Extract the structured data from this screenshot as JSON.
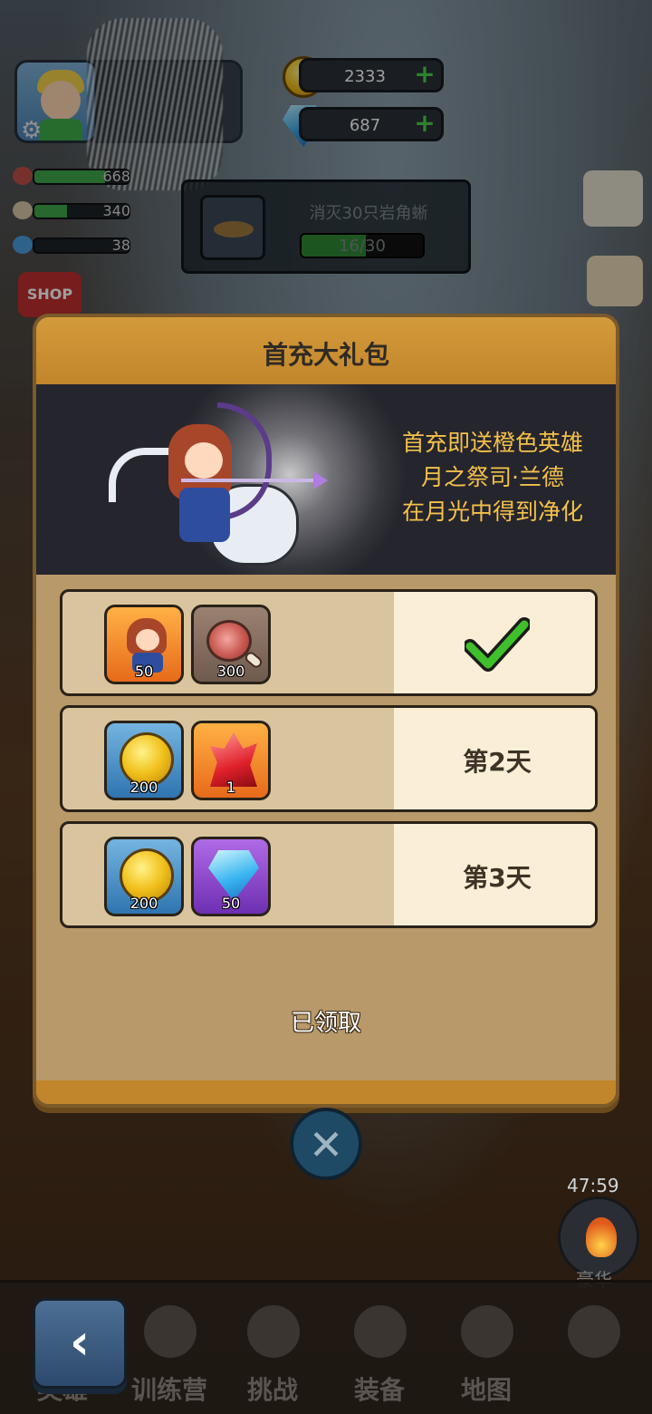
{
  "hud": {
    "coins": "2333",
    "gems": "687",
    "plus": "+",
    "stats": [
      {
        "value": "668",
        "level": 0.75
      },
      {
        "value": "340",
        "level": 0.35
      },
      {
        "value": "38",
        "level": 0.0
      }
    ],
    "quest": {
      "title": "消灭30只岩角蜥",
      "progress": "16/30",
      "level": 0.53
    },
    "shop_label": "SHOP"
  },
  "modal": {
    "title": "首充大礼包",
    "promo": [
      "首充即送橙色英雄",
      "月之祭司·兰德",
      "在月光中得到净化"
    ],
    "rows": [
      {
        "items": [
          {
            "icon": "hero-icon",
            "count": "50"
          },
          {
            "icon": "meat-icon",
            "count": "300"
          }
        ],
        "status": "claimed"
      },
      {
        "items": [
          {
            "icon": "coin-icon",
            "count": "200"
          },
          {
            "icon": "crystal-icon",
            "count": "1"
          }
        ],
        "day": "第2天"
      },
      {
        "items": [
          {
            "icon": "coin-icon",
            "count": "200"
          },
          {
            "icon": "gem-icon",
            "count": "50"
          }
        ],
        "day": "第3天"
      }
    ],
    "claimed_label": "已领取"
  },
  "close_label": "✕",
  "timer": "47:59",
  "camp_label": "豪华",
  "back_label": "‹",
  "nav": [
    "英雄",
    "训练营",
    "挑战",
    "装备",
    "地图"
  ],
  "colors": {
    "accent": "#f4c14a",
    "header": "#c1862b",
    "check": "#3fbf2a"
  }
}
